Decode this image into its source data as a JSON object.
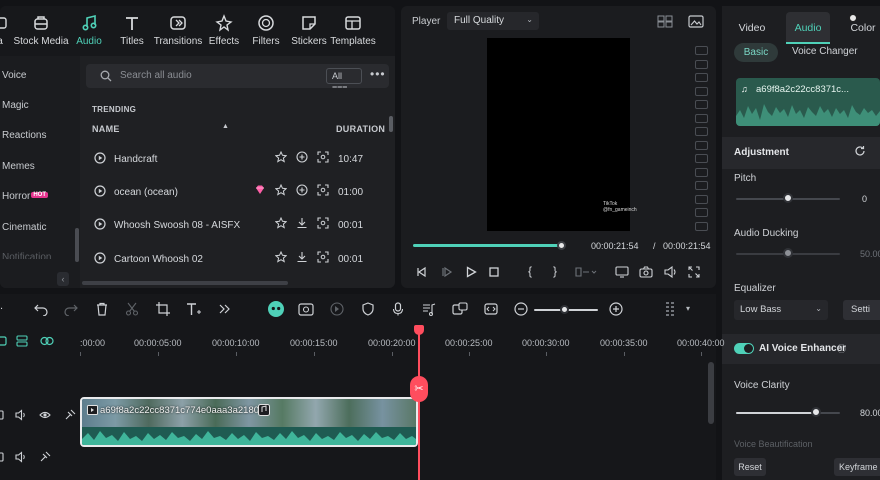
{
  "media_toolbar": {
    "items": [
      {
        "label": "a",
        "icon": "media-icon"
      },
      {
        "label": "Stock Media",
        "icon": "stock-media-icon"
      },
      {
        "label": "Audio",
        "icon": "music-note-icon",
        "active": true
      },
      {
        "label": "Titles",
        "icon": "text-T-icon"
      },
      {
        "label": "Transitions",
        "icon": "transition-icon"
      },
      {
        "label": "Effects",
        "icon": "effects-icon"
      },
      {
        "label": "Filters",
        "icon": "filter-icon"
      },
      {
        "label": "Stickers",
        "icon": "sticker-icon"
      },
      {
        "label": "Templates",
        "icon": "template-icon"
      }
    ]
  },
  "categories": [
    "Voice",
    "Magic",
    "Reactions",
    "Memes",
    "Horror",
    "Cinematic",
    "Notification"
  ],
  "hot_badge": "HOT",
  "audio_list": {
    "search_placeholder": "Search all audio",
    "filter_label": "All",
    "section": "TRENDING",
    "col_name": "NAME",
    "col_duration": "DURATION",
    "tracks": [
      {
        "name": "Handcraft",
        "duration": "10:47",
        "premium": false,
        "downloaded": true
      },
      {
        "name": "ocean (ocean)",
        "duration": "01:00",
        "premium": true,
        "downloaded": true
      },
      {
        "name": "Whoosh Swoosh 08 - AISFX",
        "duration": "00:01",
        "premium": false,
        "downloaded": false
      },
      {
        "name": "Cartoon Whoosh 02",
        "duration": "00:01",
        "premium": false,
        "downloaded": false
      }
    ]
  },
  "player": {
    "label": "Player",
    "quality": "Full Quality",
    "current_time": "00:00:21:54",
    "separator": "/",
    "total_time": "00:00:21:54",
    "progress": 1.0,
    "watermark_line1": "TikTok",
    "watermark_line2": "@fn_gameinch"
  },
  "props": {
    "tabs": [
      "Video",
      "Audio",
      "Color"
    ],
    "active_tab": "Audio",
    "subtabs": [
      "Basic",
      "Voice Changer"
    ],
    "clip_name": "a69f8a2c22cc8371c...",
    "adjustment": "Adjustment",
    "pitch": {
      "label": "Pitch",
      "value": "0",
      "level": 0.5
    },
    "ducking": {
      "label": "Audio Ducking",
      "value": "50.00",
      "level": 0.5
    },
    "equalizer": {
      "label": "Equalizer",
      "value": "Low Bass",
      "settings_label": "Setti"
    },
    "ai_enhancer": {
      "label": "AI Voice Enhancer",
      "enabled": true
    },
    "voice_clarity": {
      "label": "Voice Clarity",
      "value": "80.00",
      "level": 0.8
    },
    "voice_beautification": "Voice Beautification",
    "reset_label": "Reset",
    "keyframe_label": "Keyframe"
  },
  "timeline": {
    "ruler_labels": [
      ":00:00",
      "00:00:05:00",
      "00:00:10:00",
      "00:00:15:00",
      "00:00:20:00",
      "00:00:25:00",
      "00:00:30:00",
      "00:00:35:00",
      "00:00:40:00"
    ],
    "clip_title": "a69f8a2c22cc8371c774e0aaa3a2180c"
  },
  "colors": {
    "accent": "#4fd1b8",
    "playhead": "#ff4d5e",
    "panel": "#1f2023",
    "hot": "#e5348e"
  }
}
